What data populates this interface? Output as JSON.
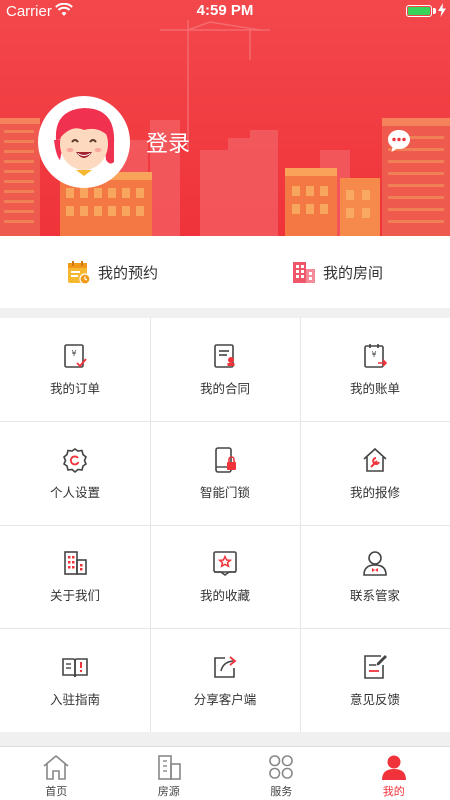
{
  "status_bar": {
    "carrier": "Carrier",
    "time": "4:59 PM"
  },
  "header": {
    "login_label": "登录"
  },
  "quick_links": [
    {
      "label": "我的预约",
      "icon": "calendar-icon"
    },
    {
      "label": "我的房间",
      "icon": "building-icon"
    }
  ],
  "grid": [
    {
      "label": "我的订单",
      "icon": "order-icon"
    },
    {
      "label": "我的合同",
      "icon": "contract-icon"
    },
    {
      "label": "我的账单",
      "icon": "bill-icon"
    },
    {
      "label": "个人设置",
      "icon": "settings-icon"
    },
    {
      "label": "智能门锁",
      "icon": "smart-lock-icon"
    },
    {
      "label": "我的报修",
      "icon": "repair-icon"
    },
    {
      "label": "关于我们",
      "icon": "about-icon"
    },
    {
      "label": "我的收藏",
      "icon": "favorite-icon"
    },
    {
      "label": "联系管家",
      "icon": "butler-icon"
    },
    {
      "label": "入驻指南",
      "icon": "guide-icon"
    },
    {
      "label": "分享客户端",
      "icon": "share-icon"
    },
    {
      "label": "意见反馈",
      "icon": "feedback-icon"
    }
  ],
  "tabs": [
    {
      "label": "首页",
      "icon": "home-icon",
      "active": false
    },
    {
      "label": "房源",
      "icon": "listing-icon",
      "active": false
    },
    {
      "label": "服务",
      "icon": "service-icon",
      "active": false
    },
    {
      "label": "我的",
      "icon": "profile-icon",
      "active": true
    }
  ],
  "colors": {
    "brand_red": "#f0333a",
    "accent_yellow": "#f5b830",
    "icon_dark": "#444444"
  }
}
